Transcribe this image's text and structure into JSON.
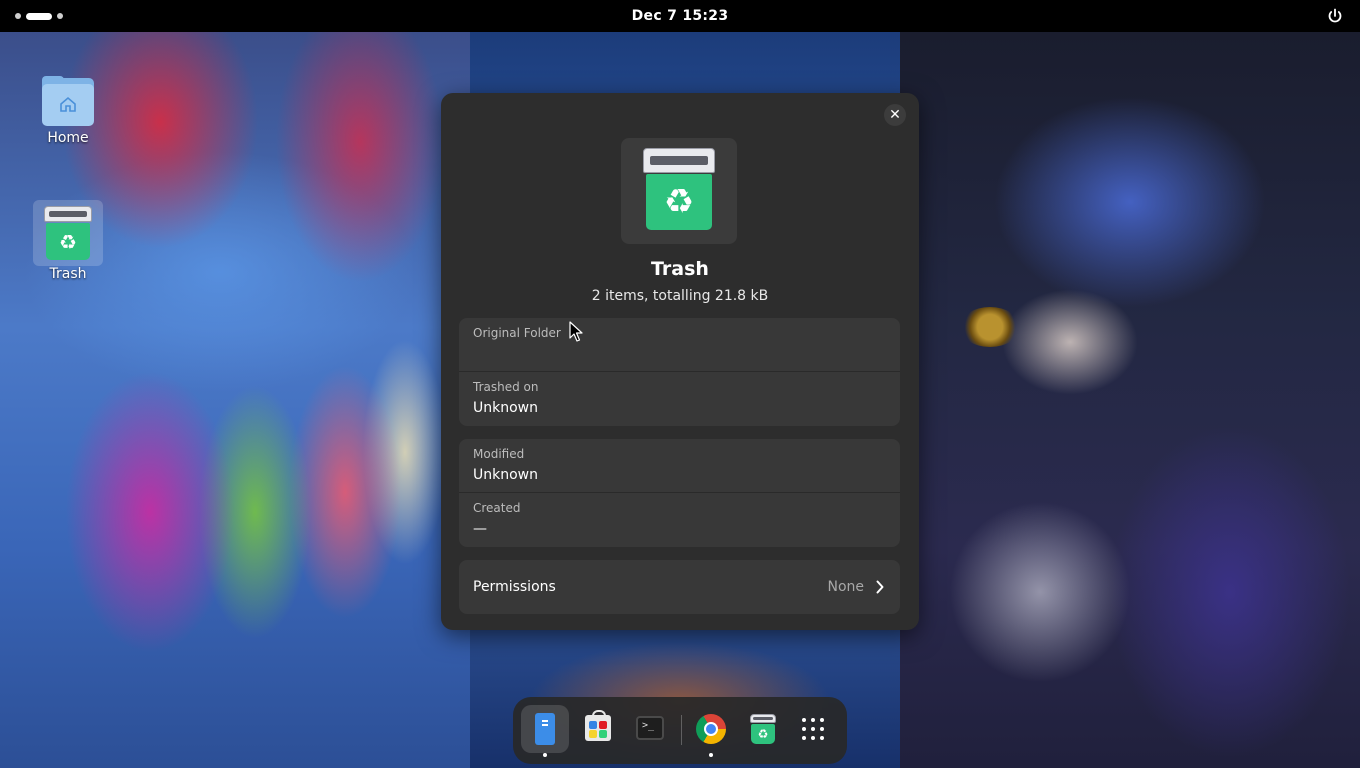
{
  "topbar": {
    "clock": "Dec 7  15:23"
  },
  "desktop": {
    "icons": [
      {
        "label": "Home",
        "icon": "folder-home-icon"
      },
      {
        "label": "Trash",
        "icon": "trash-icon",
        "selected": true
      }
    ]
  },
  "dialog": {
    "title": "Trash",
    "subtitle": "2 items, totalling 21.8 kB",
    "close_icon": "close-icon",
    "groups": [
      [
        {
          "key": "Original Folder",
          "value": ""
        },
        {
          "key": "Trashed on",
          "value": "Unknown"
        }
      ],
      [
        {
          "key": "Modified",
          "value": "Unknown"
        },
        {
          "key": "Created",
          "value": "—"
        }
      ]
    ],
    "permissions": {
      "label": "Permissions",
      "value": "None"
    }
  },
  "dock": {
    "apps": [
      {
        "name": "Files",
        "icon": "files-icon",
        "active": true,
        "running": true
      },
      {
        "name": "Software",
        "icon": "software-store-icon",
        "active": false,
        "running": false
      },
      {
        "name": "Terminal",
        "icon": "terminal-icon",
        "active": false,
        "running": false
      },
      {
        "name": "Google Chrome",
        "icon": "chrome-icon",
        "active": false,
        "running": true
      },
      {
        "name": "Trash",
        "icon": "trash-icon",
        "active": false,
        "running": false
      },
      {
        "name": "Show Apps",
        "icon": "app-grid-icon",
        "active": false,
        "running": false
      }
    ]
  },
  "colors": {
    "dialog_bg": "#2d2d2d",
    "row_bg": "#383838",
    "trash_green": "#2ec27e",
    "folder_blue": "#a4cdf2"
  }
}
